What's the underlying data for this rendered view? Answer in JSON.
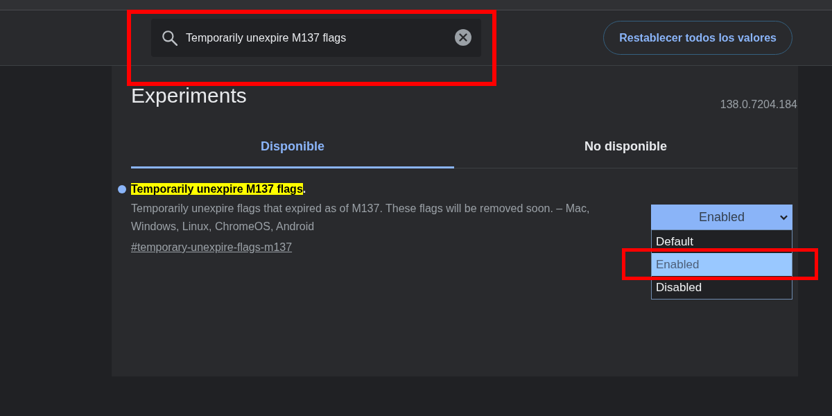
{
  "header": {
    "search": {
      "value": "Temporarily unexpire M137 flags",
      "annotated": true
    },
    "reset_button": "Restablecer todos los valores"
  },
  "page": {
    "title": "Experiments",
    "version": "138.0.7204.184"
  },
  "tabs": [
    {
      "label": "Disponible",
      "selected": true
    },
    {
      "label": "No disponible",
      "selected": false
    }
  ],
  "flags": [
    {
      "title_match": "Temporarily unexpire M137 flags",
      "title_rest": ".",
      "modified": true,
      "description": "Temporarily unexpire flags that expired as of M137. These flags will be removed soon. – Mac, Windows, Linux, ChromeOS, Android",
      "link": "#temporary-unexpire-flags-m137",
      "select": {
        "value": "Enabled",
        "expanded": true,
        "options": [
          {
            "label": "Default",
            "selected": false,
            "annotated": false
          },
          {
            "label": "Enabled",
            "selected": true,
            "annotated": true
          },
          {
            "label": "Disabled",
            "selected": false,
            "annotated": false
          }
        ]
      }
    }
  ]
}
